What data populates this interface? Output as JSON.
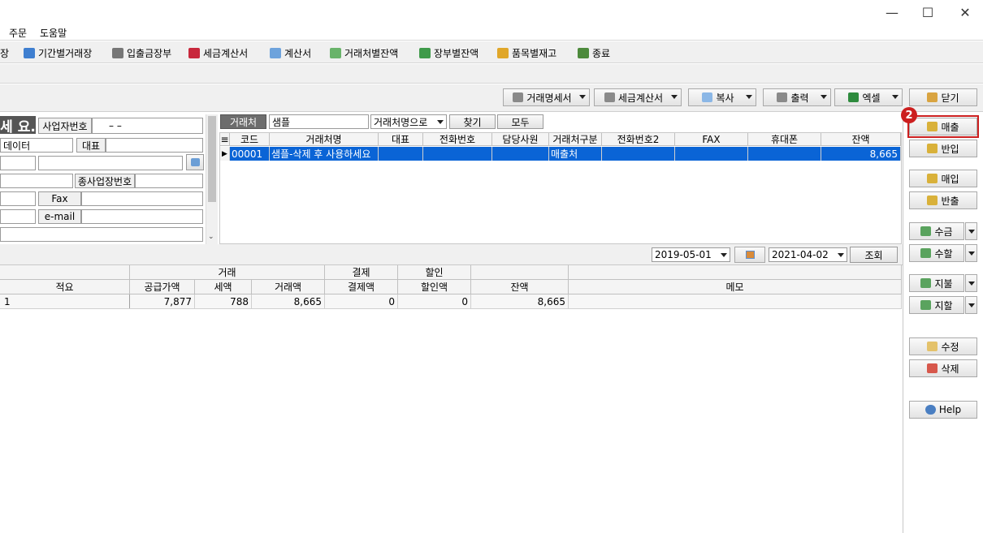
{
  "window": {
    "minimize": "—",
    "maximize": "☐",
    "close": "✕"
  },
  "menu": {
    "items": [
      "주문",
      "도움말"
    ]
  },
  "toolbar": {
    "items": [
      {
        "label": "장"
      },
      {
        "label": "기간별거래장"
      },
      {
        "label": "입출금장부"
      },
      {
        "label": "세금계산서"
      },
      {
        "label": "계산서"
      },
      {
        "label": "거래처별잔액"
      },
      {
        "label": "장부별잔액"
      },
      {
        "label": "품목별재고"
      },
      {
        "label": "종료"
      }
    ]
  },
  "actions": {
    "trade_statement": "거래명세서",
    "tax_invoice": "세금계산서",
    "copy": "복사",
    "print": "출력",
    "excel": "엑셀",
    "close": "닫기"
  },
  "side_buttons": {
    "sales": "매출",
    "return_in": "반입",
    "purchase": "매입",
    "return_out": "반출",
    "collect": "수금",
    "collect_discount": "수할",
    "payment": "지불",
    "payment_discount": "지할",
    "edit": "수정",
    "delete": "삭제",
    "help": "Help"
  },
  "marker": {
    "number": "2"
  },
  "left_panel": {
    "banner": "세 요.",
    "biz_no_label": "사업자번호",
    "biz_no_value": "–    –",
    "data_label": "데이터",
    "rep_label": "대표",
    "sub_biz_label": "종사업장번호",
    "fax_label": "Fax",
    "email_label": "e-mail"
  },
  "search": {
    "label": "거래처",
    "value": "샘플",
    "mode": "거래처명으로",
    "find": "찾기",
    "all": "모두"
  },
  "client_grid": {
    "headers": [
      "코드",
      "거래처명",
      "대표",
      "전화번호",
      "담당사원",
      "거래처구분",
      "전화번호2",
      "FAX",
      "휴대폰",
      "잔액"
    ],
    "rows": [
      {
        "code": "00001",
        "name": "샘플-삭제 후 사용하세요",
        "rep": "",
        "phone": "",
        "staff": "",
        "type": "매출처",
        "phone2": "",
        "fax": "",
        "mobile": "",
        "balance": "8,665"
      }
    ]
  },
  "date_range": {
    "from": "2019-05-01",
    "to": "2021-04-02",
    "query": "조회"
  },
  "ledger_grid": {
    "group_headers": {
      "trade": "거래",
      "settle": "결제",
      "discount": "할인"
    },
    "headers": {
      "summary": "적요",
      "supply": "공급가액",
      "tax": "세액",
      "amount": "거래액",
      "settle_amount": "결제액",
      "discount_amount": "할인액",
      "balance": "잔액",
      "memo": "메모"
    },
    "rows": [
      {
        "summary": "1",
        "supply": "7,877",
        "tax": "788",
        "amount": "8,665",
        "settle_amount": "0",
        "discount_amount": "0",
        "balance": "8,665",
        "memo": ""
      }
    ]
  },
  "colors": {
    "selection": "#0a64d6",
    "highlight_border": "#cc1f1f",
    "marker_bg": "#cc1f1f"
  }
}
